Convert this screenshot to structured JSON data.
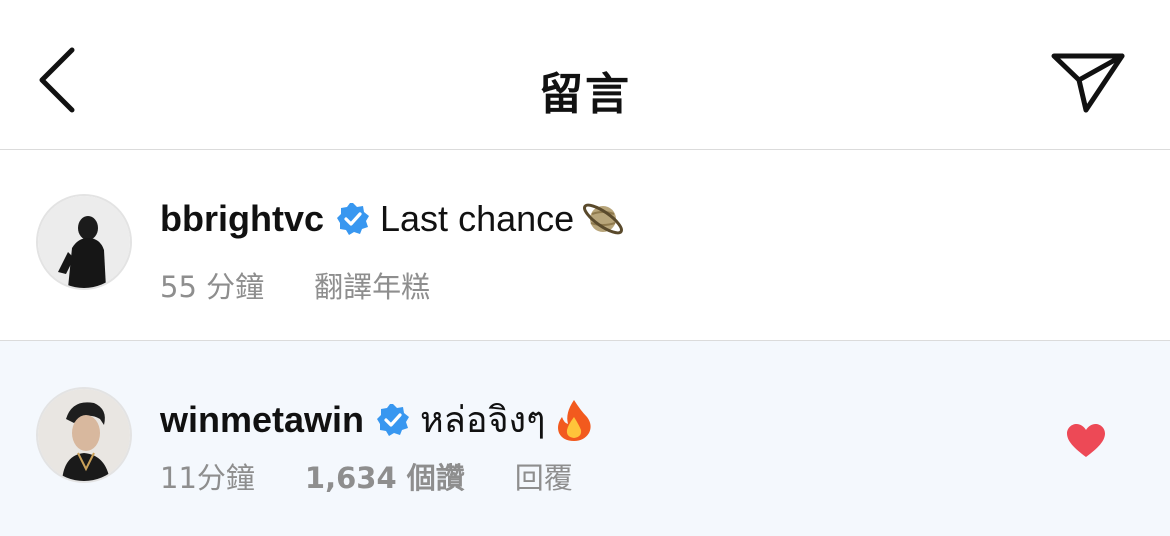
{
  "header": {
    "title": "留言",
    "back_icon": "chevron-left-icon",
    "share_icon": "paper-plane-icon"
  },
  "comments": [
    {
      "username": "bbrightvc",
      "verified": true,
      "text": "Last chance",
      "emoji": "ringed-planet",
      "time": "55 分鐘",
      "action": "翻譯年糕"
    },
    {
      "username": "winmetawin",
      "verified": true,
      "text": "หล่อจิงๆ",
      "emoji": "fire",
      "time": "11分鐘",
      "likes": "1,634 個讚",
      "reply": "回覆",
      "liked": true
    }
  ],
  "colors": {
    "verified_blue": "#3897f0",
    "heart_red": "#ed4956",
    "highlight_bg": "#f4f8fd",
    "meta_gray": "#8e8e8e"
  }
}
